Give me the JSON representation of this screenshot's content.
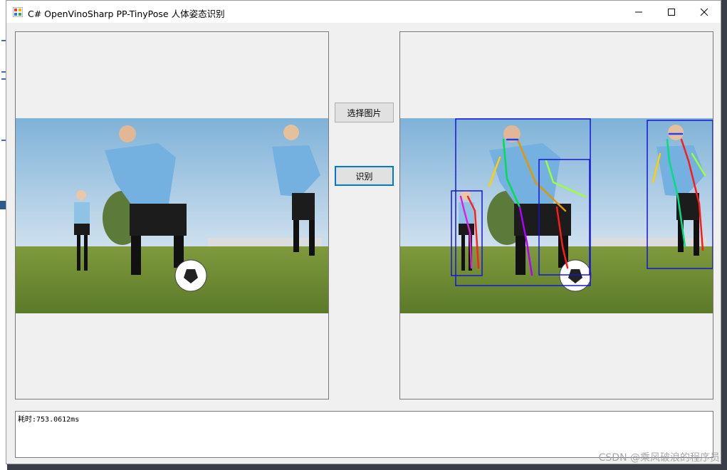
{
  "window": {
    "title": "C# OpenVinoSharp PP-TinyPose 人体姿态识别"
  },
  "buttons": {
    "select_image": "选择图片",
    "recognize": "识别"
  },
  "log": {
    "text": "耗时:753.0612ms"
  },
  "watermark": "CSDN @乘风破浪的程序员"
}
